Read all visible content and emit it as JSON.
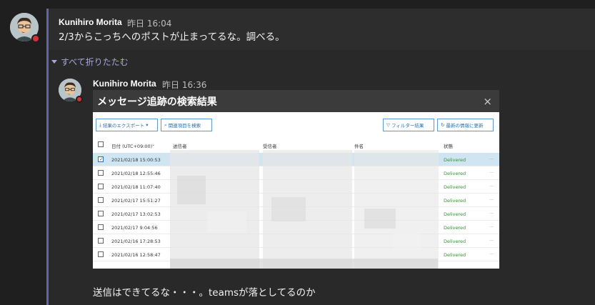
{
  "post1": {
    "author": "Kunihiro Morita",
    "time": "昨日 16:04",
    "text": "2/3からこっちへのポストが止まってるな。調べる。"
  },
  "collapse_label": "すべて折りたたむ",
  "post2": {
    "author": "Kunihiro Morita",
    "time": "昨日 16:36",
    "text": "送信はできてるな・・・。teamsが落としてるのか"
  },
  "screenshot": {
    "title": "メッセージ追跡の検索結果",
    "close": "×",
    "toolbar": {
      "export": "結果のエクスポート",
      "related": "関連項目を検索",
      "filter": "フィルター結果",
      "refresh": "最新の情報に更新"
    },
    "columns": {
      "date": "日付 (UTC+09:00)",
      "sender": "送信者",
      "recipient": "受信者",
      "subject": "件名",
      "status": "状態"
    },
    "rows": [
      {
        "date": "2021/02/18 15:00:53",
        "status": "Delivered",
        "selected": true
      },
      {
        "date": "2021/02/18 12:55:46",
        "status": "Delivered",
        "selected": false
      },
      {
        "date": "2021/02/18 11:07:40",
        "status": "Delivered",
        "selected": false
      },
      {
        "date": "2021/02/17 15:51:27",
        "status": "Delivered",
        "selected": false
      },
      {
        "date": "2021/02/17 13:02:53",
        "status": "Delivered",
        "selected": false
      },
      {
        "date": "2021/02/17 9:04:56",
        "status": "Delivered",
        "selected": false
      },
      {
        "date": "2021/02/16 17:28:53",
        "status": "Delivered",
        "selected": false
      },
      {
        "date": "2021/02/16 12:58:47",
        "status": "Delivered",
        "selected": false
      }
    ]
  },
  "colors": {
    "accent": "#6264a7",
    "presence": "#d13438",
    "delivered": "#3c8c3c"
  }
}
